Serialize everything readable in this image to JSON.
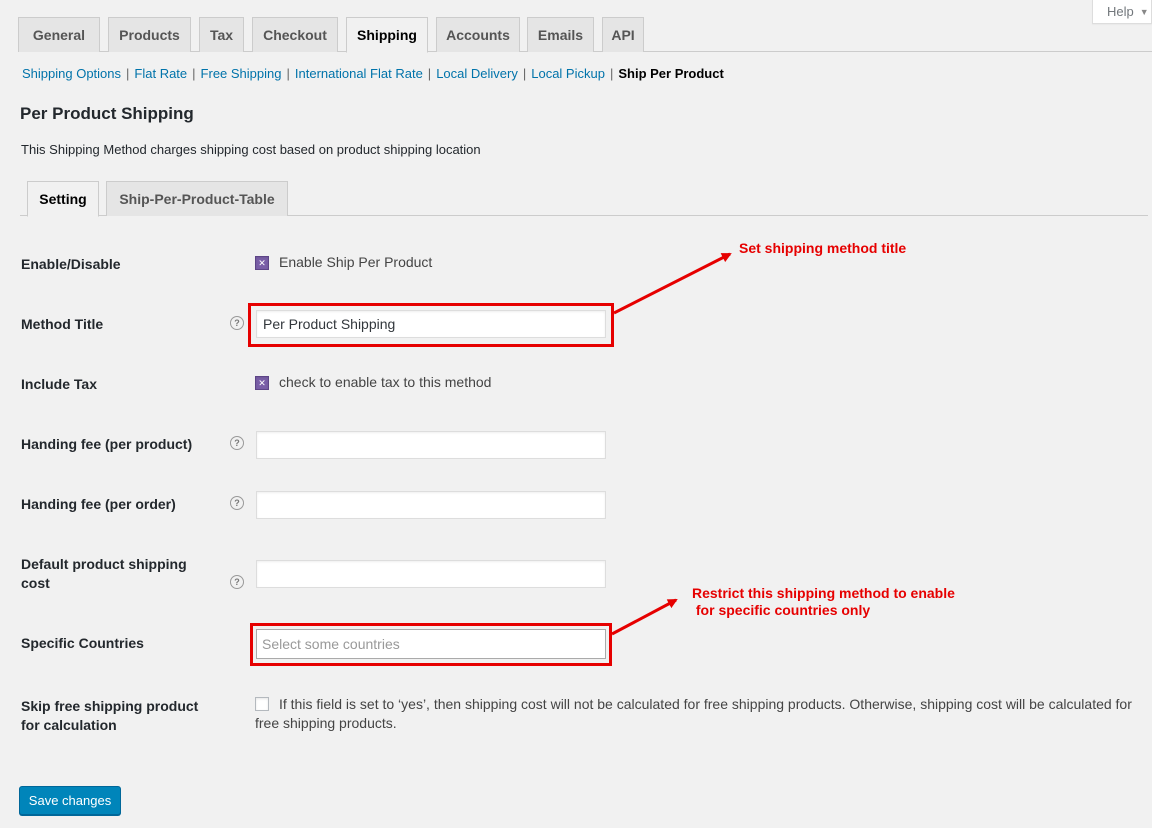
{
  "help_tab": {
    "label": "Help"
  },
  "main_tabs": [
    {
      "label": "General"
    },
    {
      "label": "Products"
    },
    {
      "label": "Tax"
    },
    {
      "label": "Checkout"
    },
    {
      "label": "Shipping",
      "active": true
    },
    {
      "label": "Accounts"
    },
    {
      "label": "Emails"
    },
    {
      "label": "API"
    }
  ],
  "subsections": [
    {
      "label": "Shipping Options"
    },
    {
      "label": "Flat Rate"
    },
    {
      "label": "Free Shipping"
    },
    {
      "label": "International Flat Rate"
    },
    {
      "label": "Local Delivery"
    },
    {
      "label": "Local Pickup"
    },
    {
      "label": "Ship Per Product",
      "current": true
    }
  ],
  "page": {
    "title": "Per Product Shipping",
    "description": "This Shipping Method charges shipping cost based on product shipping location"
  },
  "inner_tabs": [
    {
      "label": "Setting",
      "active": true
    },
    {
      "label": "Ship-Per-Product-Table"
    }
  ],
  "form": {
    "enable": {
      "label": "Enable/Disable",
      "checkbox_label": "Enable Ship Per Product",
      "checked": true
    },
    "method_title": {
      "label": "Method Title",
      "value": "Per Product Shipping"
    },
    "include_tax": {
      "label": "Include Tax",
      "checkbox_label": "check to enable tax to this method",
      "checked": true
    },
    "fee_per_product": {
      "label": "Handing fee (per product)",
      "value": ""
    },
    "fee_per_order": {
      "label": "Handing fee (per order)",
      "value": ""
    },
    "default_cost": {
      "label_line1": "Default product shipping",
      "label_line2": "cost",
      "value": ""
    },
    "countries": {
      "label": "Specific Countries",
      "placeholder": "Select some countries"
    },
    "skip_free": {
      "label_line1": "Skip free shipping product",
      "label_line2": "for calculation",
      "description": "If this field is set to ‘yes’, then shipping cost will not be calculated for free shipping products. Otherwise, shipping cost will be calculated for free shipping products.",
      "checked": false
    }
  },
  "save_button": {
    "label": "Save changes"
  },
  "annotations": {
    "title_note": "Set shipping method title",
    "countries_note": "Restrict this shipping method to enable\n for specific countries only"
  },
  "colors": {
    "accent": "#0073aa",
    "button": "#0085ba",
    "checkbox": "#7a5fa8",
    "annotation": "#e60000"
  }
}
